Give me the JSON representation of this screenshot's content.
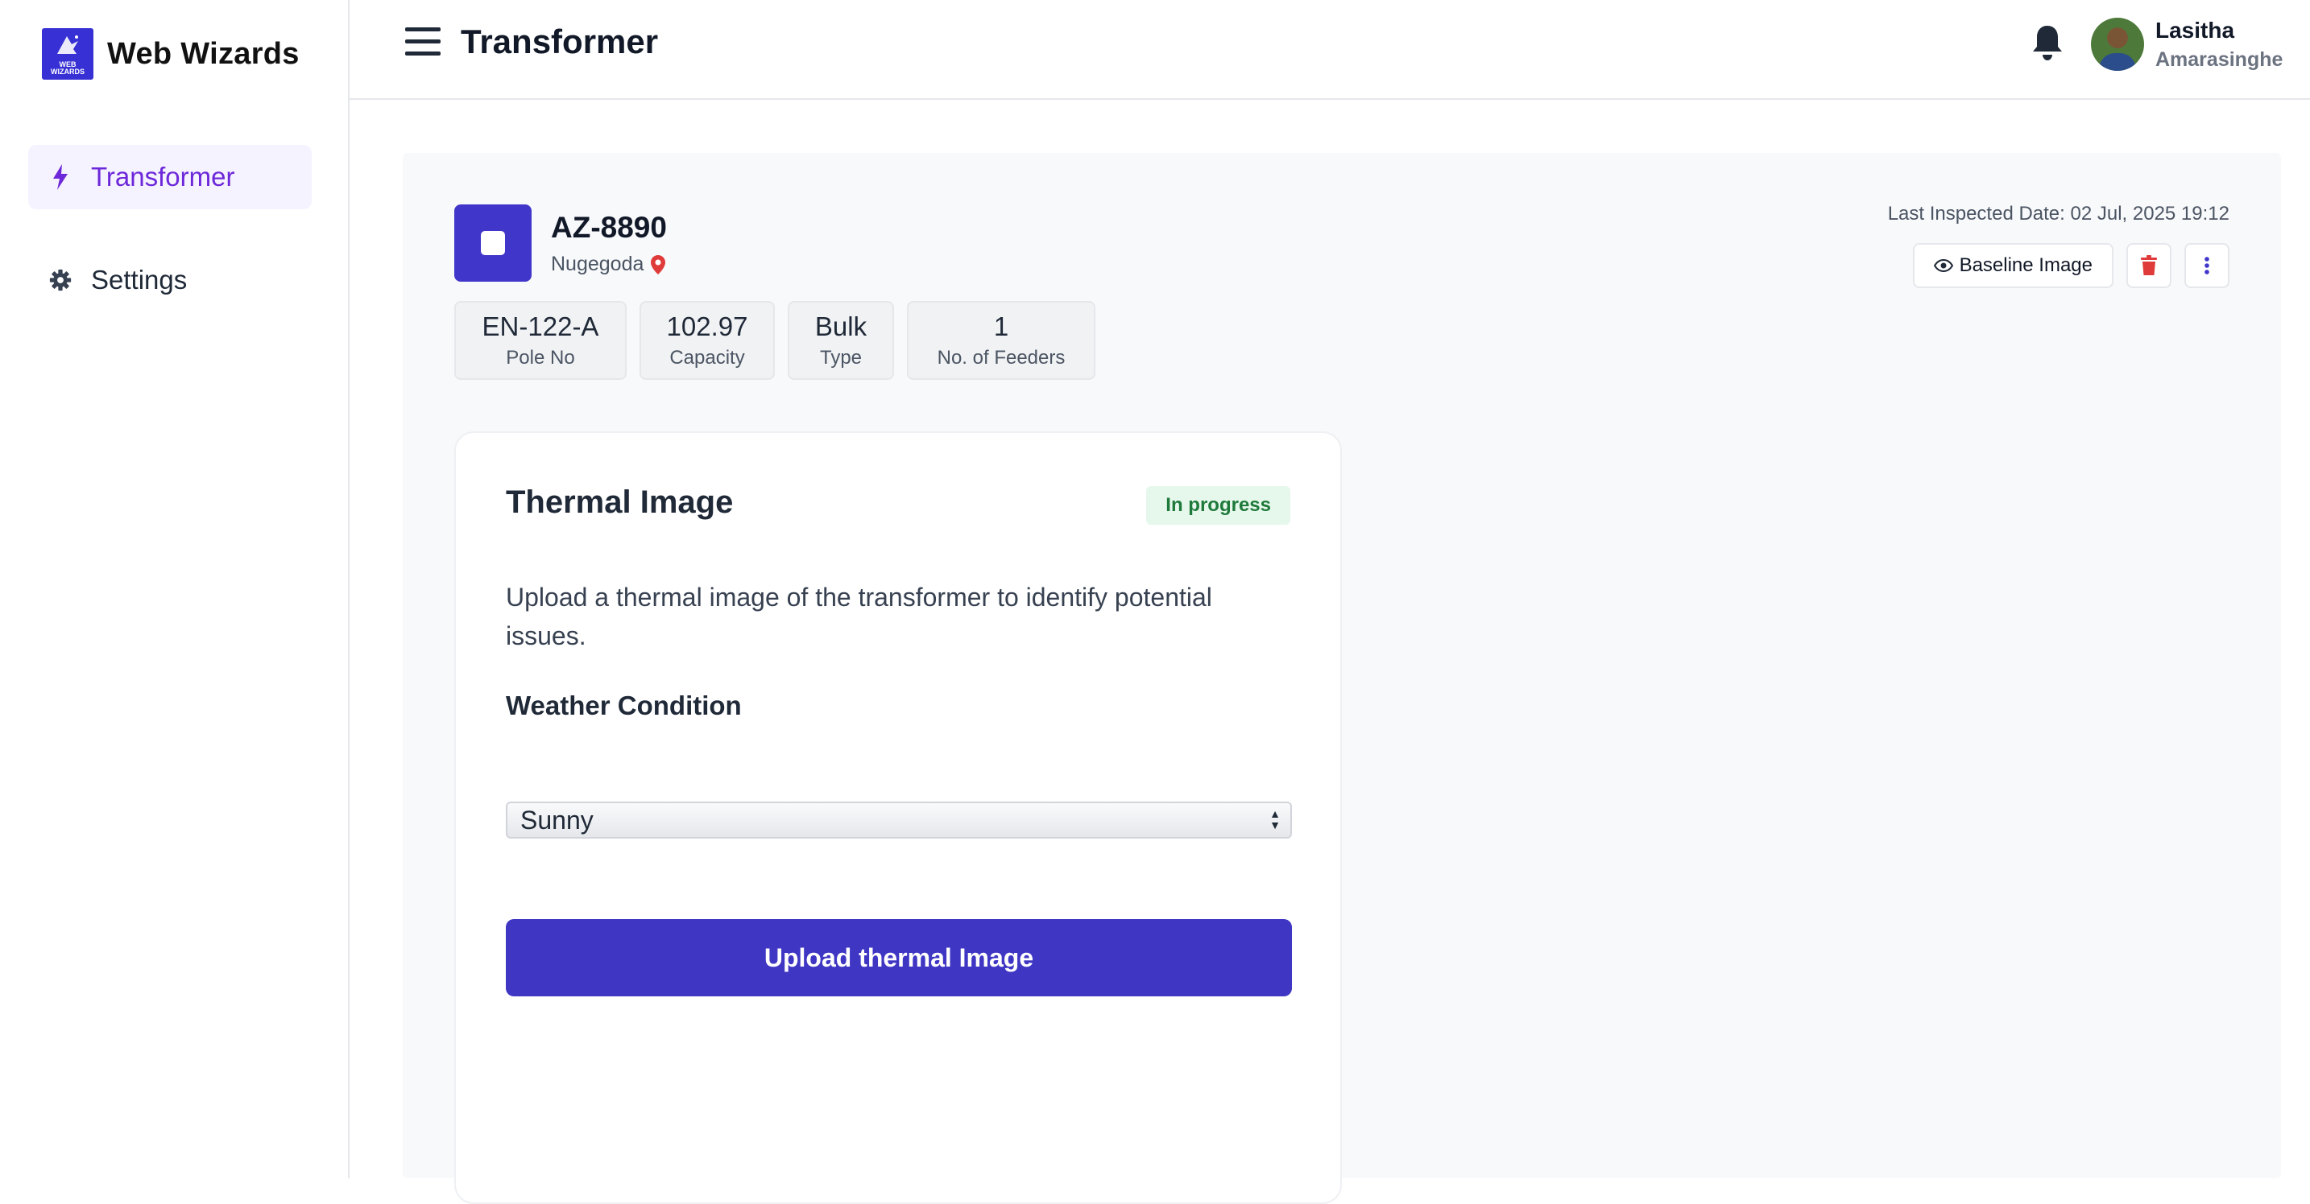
{
  "brand": {
    "name": "Web Wizards",
    "logo_text": "WEB WIZARDS"
  },
  "sidebar": {
    "items": [
      {
        "label": "Transformer",
        "icon": "bolt-icon",
        "active": true
      },
      {
        "label": "Settings",
        "icon": "gear-icon",
        "active": false
      }
    ]
  },
  "header": {
    "title": "Transformer",
    "user": {
      "first_name": "Lasitha",
      "last_name": "Amarasinghe"
    }
  },
  "transformer": {
    "id": "AZ-8890",
    "location": "Nugegoda",
    "last_inspected": "Last Inspected Date: 02 Jul, 2025 19:12",
    "stats": [
      {
        "value": "EN-122-A",
        "label": "Pole No"
      },
      {
        "value": "102.97",
        "label": "Capacity"
      },
      {
        "value": "Bulk",
        "label": "Type"
      },
      {
        "value": "1",
        "label": "No. of Feeders"
      }
    ],
    "baseline_button": "Baseline Image"
  },
  "thermal": {
    "title": "Thermal Image",
    "status": "In progress",
    "description": "Upload a thermal image of the transformer to identify potential issues.",
    "weather_label": "Weather Condition",
    "weather_value": "Sunny",
    "upload_button": "Upload thermal Image"
  },
  "colors": {
    "brand": "#3730d4",
    "accent": "#4036c9",
    "active_nav_bg": "#f5f3ff",
    "active_nav_text": "#6d28d9",
    "status_bg": "#e6f7ec",
    "status_text": "#1e7a3a",
    "danger": "#e03b3b"
  }
}
